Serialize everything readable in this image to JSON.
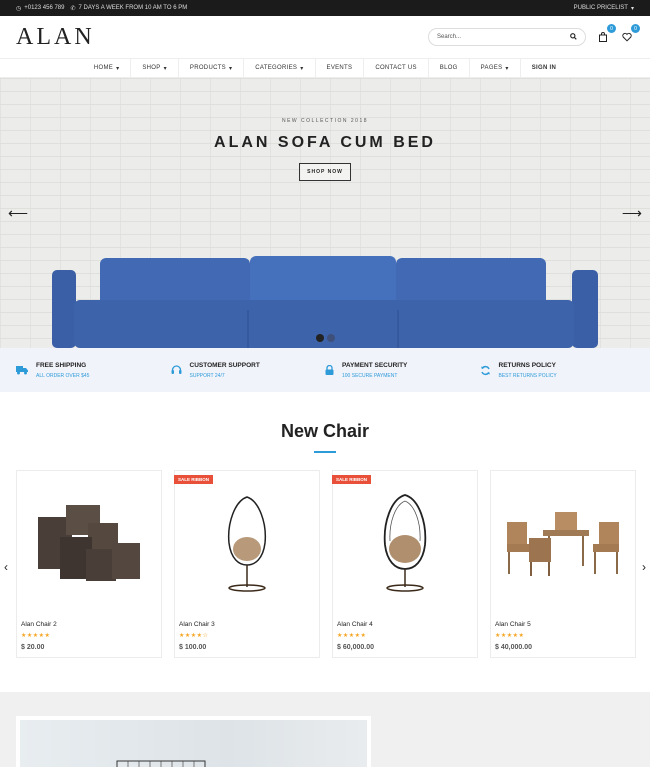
{
  "topbar": {
    "phone": "+0123 456 789",
    "hours": "7 DAYS A WEEK FROM 10 AM TO 6 PM",
    "pricelist": "PUBLIC PRICELIST"
  },
  "header": {
    "logo": "ALAN",
    "search_placeholder": "Search...",
    "cart_count": "0",
    "wishlist_count": "0"
  },
  "nav": {
    "items": [
      "HOME",
      "SHOP",
      "PRODUCTS",
      "CATEGORIES",
      "EVENTS",
      "CONTACT US",
      "BLOG",
      "PAGES",
      "SIGN IN"
    ]
  },
  "hero": {
    "subtitle": "NEW COLLECTION 2018",
    "title": "ALAN SOFA CUM BED",
    "button": "SHOP NOW"
  },
  "features": [
    {
      "title": "FREE SHIPPING",
      "sub": "ALL ORDER OVER $45",
      "icon": "truck-icon"
    },
    {
      "title": "CUSTOMER SUPPORT",
      "sub": "SUPPORT 24/7",
      "icon": "headset-icon"
    },
    {
      "title": "PAYMENT SECURITY",
      "sub": "100 SECURE PAYMENT",
      "icon": "lock-icon"
    },
    {
      "title": "RETURNS POLICY",
      "sub": "BEST RETURNS POLICY",
      "icon": "refresh-icon"
    }
  ],
  "section": {
    "title": "New Chair"
  },
  "products": [
    {
      "name": "Alan Chair 2",
      "price": "$ 20.00",
      "stars": "★★★★★",
      "ribbon": ""
    },
    {
      "name": "Alan Chair 3",
      "price": "$ 100.00",
      "stars": "★★★★☆",
      "ribbon": "SALE RIBBON"
    },
    {
      "name": "Alan Chair 4",
      "price": "$ 60,000.00",
      "stars": "★★★★★",
      "ribbon": "SALE RIBBON"
    },
    {
      "name": "Alan Chair 5",
      "price": "$ 40,000.00",
      "stars": "★★★★★",
      "ribbon": ""
    }
  ],
  "colors": {
    "accent": "#2e9bd9",
    "ribbon": "#e8503a",
    "star": "#f5a623",
    "sofa": "#3f66b0"
  }
}
